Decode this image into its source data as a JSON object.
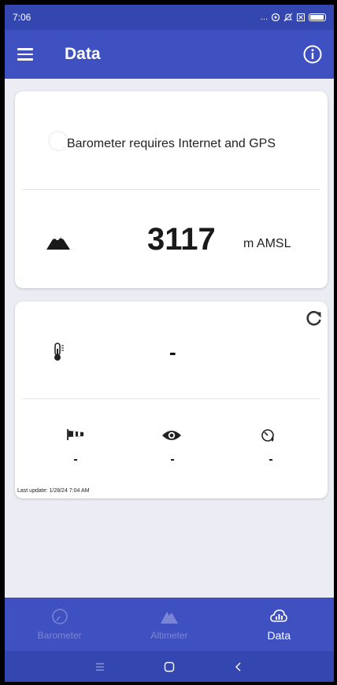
{
  "status_bar": {
    "time": "7:06",
    "dots": "..."
  },
  "app_bar": {
    "title": "Data"
  },
  "barometer_card": {
    "message": "Barometer requires Internet and GPS",
    "altitude_value": "3117",
    "altitude_unit": "m AMSL"
  },
  "weather_card": {
    "temperature": "-",
    "wind": "-",
    "visibility": "-",
    "pressure": "-",
    "last_update": "Last update: 1/28/24 7:04 AM"
  },
  "bottom_nav": {
    "items": [
      {
        "label": "Barometer",
        "icon": "gauge-icon",
        "active": false
      },
      {
        "label": "Altimeter",
        "icon": "mountain-icon",
        "active": false
      },
      {
        "label": "Data",
        "icon": "cloud-chart-icon",
        "active": true
      }
    ]
  },
  "colors": {
    "primary": "#3F51C1",
    "primary_dark": "#3446AF",
    "background": "#ECEDF4",
    "nav_inactive": "#7A86D3"
  }
}
